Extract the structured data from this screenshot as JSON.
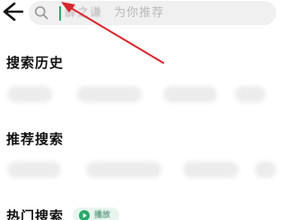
{
  "search": {
    "text": "薛之谦",
    "hint": "为你推荐"
  },
  "sections": {
    "history_title": "搜索历史",
    "recommend_title": "推荐搜索",
    "hot_title": "热门搜索",
    "hot_tag_label": "播放"
  },
  "colors": {
    "accent": "#2aa86a",
    "annotation_arrow": "#d9262b"
  },
  "icons": {
    "back": "back-arrow-icon",
    "search": "search-icon",
    "play": "play-icon"
  }
}
